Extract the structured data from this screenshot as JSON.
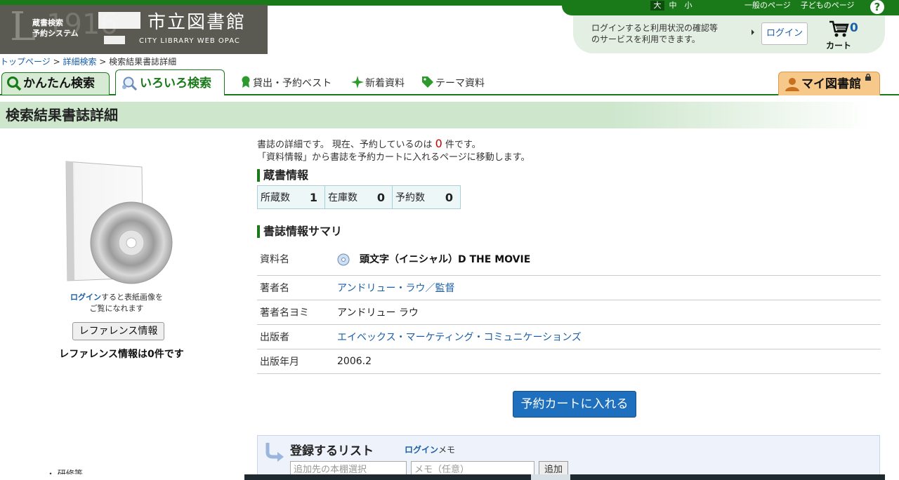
{
  "header": {
    "font_sizes": [
      "大",
      "中",
      "小"
    ],
    "page_links": [
      "一般のページ",
      "子どものページ"
    ],
    "help": "?",
    "logo": {
      "system_line1": "蔵書検索",
      "system_line2": "予約システム",
      "library_name": "市立図書館",
      "english": "CITY LIBRARY WEB OPAC"
    },
    "login_message_line1": "ログインすると利用状況の確認等",
    "login_message_line2": "のサービスを利用できます。",
    "login_button": "ログイン",
    "cart_count": "0",
    "cart_label": "カート"
  },
  "breadcrumb": {
    "home": "トップページ",
    "sep1": " > ",
    "advanced": "詳細検索",
    "sep2": " > ",
    "current": "検索結果書誌詳細"
  },
  "tabs": {
    "simple": "かんたん検索",
    "advanced": "いろいろ検索",
    "best": "貸出・予約ベスト",
    "new": "新着資料",
    "theme": "テーマ資料",
    "mylibrary": "マイ図書館"
  },
  "page_title": "検索結果書誌詳細",
  "left": {
    "login_word": "ログイン",
    "cover_note_rest": "すると表紙画像を",
    "cover_note_line2": "ご覧になれます",
    "reference_button": "レファレンス情報",
    "reference_count": "レファレンス情報は0件です",
    "cut_text": "・ 研修等"
  },
  "intro": {
    "line1_pre": "書誌の詳細です。 現在、予約しているのは ",
    "count": "0",
    "line1_post": " 件です。",
    "line2": "「資料情報」から書誌を予約カートに入れるページに移動します。"
  },
  "holdings": {
    "heading": "蔵書情報",
    "owned_label": "所蔵数",
    "owned_value": "1",
    "instock_label": "在庫数",
    "instock_value": "0",
    "reserved_label": "予約数",
    "reserved_value": "0"
  },
  "summary": {
    "heading": "書誌情報サマリ",
    "rows": [
      {
        "label": "資料名",
        "value": "頭文字（イニシャル）D THE MOVIE"
      },
      {
        "label": "著者名",
        "value": "アンドリュー・ラウ／監督"
      },
      {
        "label": "著者名ヨミ",
        "value": "アンドリュー ラウ"
      },
      {
        "label": "出版者",
        "value": "エイベックス・マーケティング・コミュニケーションズ"
      },
      {
        "label": "出版年月",
        "value": "2006.2"
      }
    ]
  },
  "reserve_button": "予約カートに入れる",
  "list_box": {
    "title": "登録するリスト",
    "login": "ログイン",
    "memo_word": "メモ",
    "select_placeholder": "追加先の本棚選択",
    "memo_placeholder": "メモ（任意）",
    "add_button": "追加"
  },
  "colors": {
    "brand_green": "#1a7a1a",
    "link_blue": "#1a5fa8",
    "reserve_blue": "#1e6fbd",
    "mylib_orange": "#f6c98a"
  }
}
